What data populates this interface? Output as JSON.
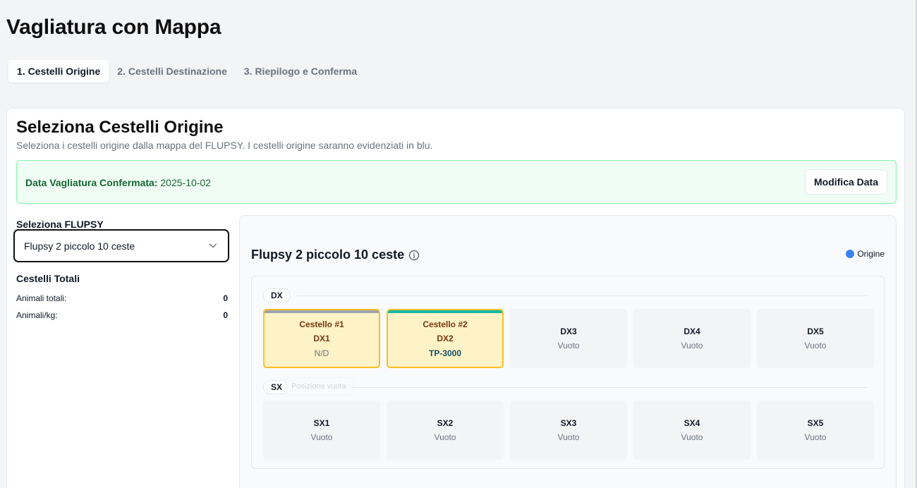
{
  "page": {
    "title": "Vagliatura con Mappa"
  },
  "tabs": [
    {
      "label": "1. Cestelli Origine",
      "active": true
    },
    {
      "label": "2. Cestelli Destinazione",
      "active": false
    },
    {
      "label": "3. Riepilogo e Conferma",
      "active": false
    }
  ],
  "card": {
    "title": "Seleziona Cestelli Origine",
    "description": "Seleziona i cestelli origine dalla mappa del FLUPSY. I cestelli origine saranno evidenziati in blu."
  },
  "alert": {
    "label": "Data Vagliatura Confermata:",
    "date": "2025-10-02",
    "button": "Modifica Data"
  },
  "left": {
    "flupsy_label": "Seleziona FLUPSY",
    "flupsy_value": "Flupsy 2 piccolo 10 ceste",
    "totals_title": "Cestelli Totali",
    "stats": [
      {
        "label": "Animali totali:",
        "value": "0"
      },
      {
        "label": "Animali/kg:",
        "value": "0"
      }
    ]
  },
  "map": {
    "title": "Flupsy 2 piccolo 10 ceste",
    "legend_label": "Origine",
    "legend_color": "#3b82f6",
    "tooltip": "Posizione vuota",
    "rows": [
      {
        "label": "DX",
        "baskets": [
          {
            "filled": true,
            "name": "Cestello #1",
            "position": "DX1",
            "size": "N/D",
            "stripe": "#9ca3af"
          },
          {
            "filled": true,
            "name": "Cestello #2",
            "position": "DX2",
            "size": "TP-3000",
            "stripe": "#14b8a6"
          },
          {
            "filled": false,
            "position": "DX3",
            "state": "Vuoto"
          },
          {
            "filled": false,
            "position": "DX4",
            "state": "Vuoto"
          },
          {
            "filled": false,
            "position": "DX5",
            "state": "Vuoto"
          }
        ]
      },
      {
        "label": "SX",
        "baskets": [
          {
            "filled": false,
            "position": "SX1",
            "state": "Vuoto"
          },
          {
            "filled": false,
            "position": "SX2",
            "state": "Vuoto"
          },
          {
            "filled": false,
            "position": "SX3",
            "state": "Vuoto"
          },
          {
            "filled": false,
            "position": "SX4",
            "state": "Vuoto"
          },
          {
            "filled": false,
            "position": "SX5",
            "state": "Vuoto"
          }
        ]
      }
    ]
  }
}
